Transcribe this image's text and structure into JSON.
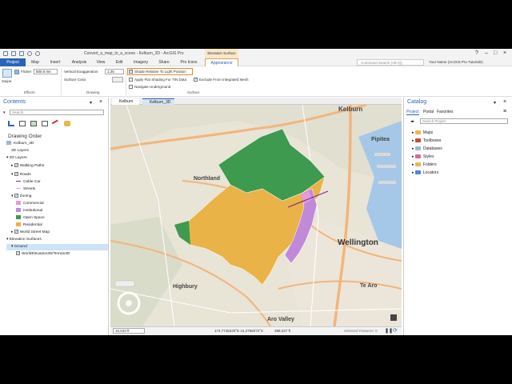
{
  "titlebar": {
    "title": "Convert_a_map_to_a_scene - Kelburn_3D - ArcGIS Pro",
    "context_group": "Elevation Surface"
  },
  "tabs": [
    "Project",
    "Map",
    "Insert",
    "Analysis",
    "View",
    "Edit",
    "Imagery",
    "Share",
    "Pro Icons",
    "Appearance"
  ],
  "command_search": {
    "placeholder": "Command Search (Alt+Q)"
  },
  "user": {
    "name": "Your Name (ArcGIS Pro Tutorials)"
  },
  "ribbon": {
    "swipe_label": "Swipe",
    "flicker_label": "Flicker",
    "flicker_value": "500.0 ms",
    "effects_group": "Effects",
    "vertical_exaggeration_label": "Vertical Exaggeration",
    "vertical_exaggeration_value": "1.25",
    "surface_color_label": "Surface Color",
    "drawing_group": "Drawing",
    "shade_relative": "Shade Relative To Light Position",
    "flat_shading": "Apply Flat Shading For TIN Data",
    "navigate_underground": "Navigate Underground",
    "exclude_mesh": "Exclude From Integrated Mesh",
    "surface_group": "Surface"
  },
  "contents": {
    "title": "Contents",
    "search_placeholder": "Search",
    "drawing_order": "Drawing Order",
    "items": [
      {
        "label": "Kelburn_3D"
      },
      {
        "label": "3D Layers"
      },
      {
        "label": "2D Layers"
      },
      {
        "label": "Walking Paths"
      },
      {
        "label": "Roads"
      },
      {
        "label": "Cable Car"
      },
      {
        "label": "Streets"
      },
      {
        "label": "Zoning"
      },
      {
        "label": "Commercial"
      },
      {
        "label": "Institutional"
      },
      {
        "label": "Open Space"
      },
      {
        "label": "Residential"
      },
      {
        "label": "World Street Map"
      },
      {
        "label": "Elevation Surfaces"
      },
      {
        "label": "Ground"
      },
      {
        "label": "WorldElevation3D/Terrain3D"
      }
    ],
    "colors": {
      "commercial": "#e89ad8",
      "institutional": "#c08ad8",
      "open_space": "#3d9a4e",
      "residential": "#e9b347",
      "cable_car": "#7a2f8a"
    }
  },
  "map": {
    "tabs": [
      "Kelburn",
      "Kelburn_3D"
    ],
    "labels": [
      "Kelburn",
      "Pipitea",
      "Northland",
      "Wellington",
      "Highbury",
      "Te Aro",
      "Aro Valley"
    ],
    "scale": "16,633 ft",
    "coordinates": "174.7745220°E 41.2756072°S",
    "elevation": "388.227 ft",
    "selected_features": "Selected Features: 0"
  },
  "catalog": {
    "title": "Catalog",
    "tabs": [
      "Project",
      "Portal",
      "Favorites"
    ],
    "search_placeholder": "Search Project",
    "items": [
      "Maps",
      "Toolboxes",
      "Databases",
      "Styles",
      "Folders",
      "Locators"
    ]
  }
}
